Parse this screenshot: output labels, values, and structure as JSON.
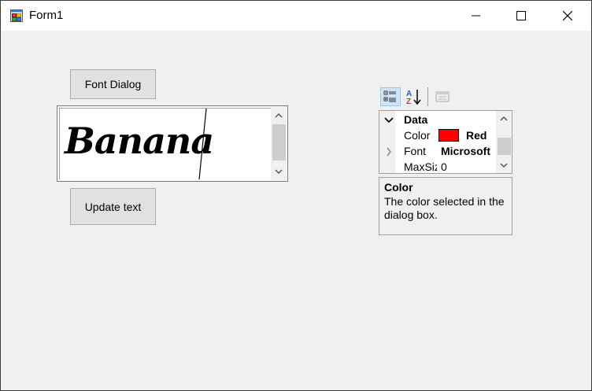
{
  "window": {
    "title": "Form1",
    "icon": "winforms-app-icon",
    "controls": [
      "minimize-icon",
      "maximize-icon",
      "close-icon"
    ]
  },
  "form": {
    "font_dialog_label": "Font Dialog",
    "update_text_label": "Update text",
    "rich_text": "Banana"
  },
  "property_grid": {
    "toolbar": [
      "categorized-icon",
      "alphabetical-icon",
      "property-pages-icon"
    ],
    "category": "Data",
    "rows": [
      {
        "name": "Color",
        "value": "Red",
        "swatch": "#ff0000"
      },
      {
        "name": "Font",
        "value": "Microsoft",
        "expander": "chevron-right-icon"
      },
      {
        "name": "MaxSiz",
        "value": "0"
      }
    ],
    "help_title": "Color",
    "help_text": "The color selected in the dialog box."
  }
}
